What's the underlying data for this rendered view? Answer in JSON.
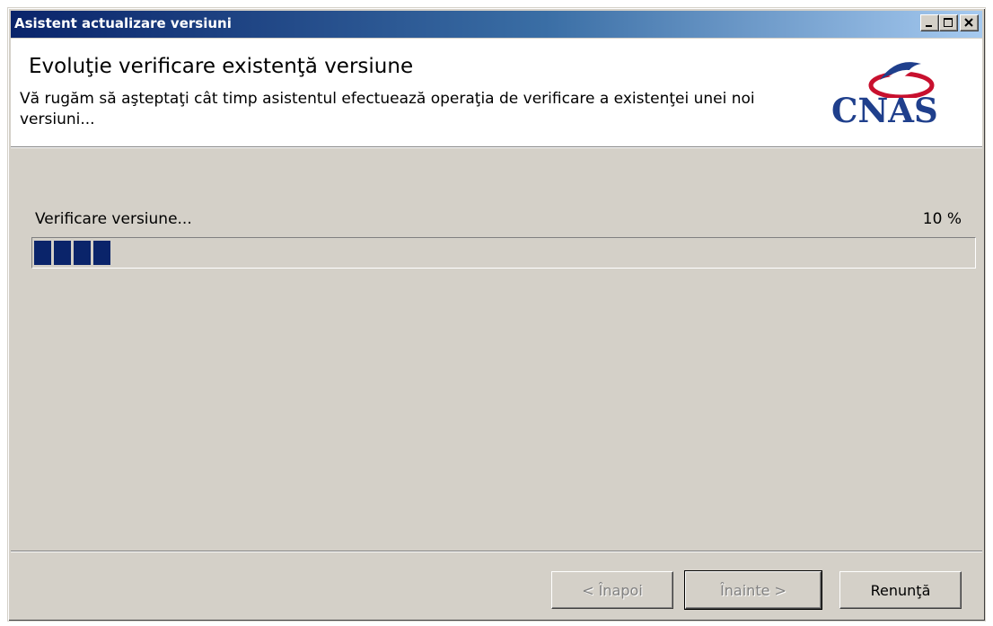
{
  "window": {
    "title": "Asistent actualizare versiuni",
    "controls": {
      "minimize_icon": "minimize-icon",
      "maximize_icon": "maximize-icon",
      "close_icon": "close-icon"
    }
  },
  "header": {
    "title": "Evoluţie verificare existenţă versiune",
    "description": "Vă rugăm să aşteptaţi cât timp asistentul efectuează operaţia de verificare a existenţei unei noi versiuni...",
    "logo_text": "CNAS"
  },
  "progress": {
    "label": "Verificare versiune...",
    "percent_text": "10 %",
    "value_percent": 10
  },
  "buttons": {
    "back_label": "< Înapoi",
    "next_label": "Înainte >",
    "cancel_label": "Renunţă",
    "back_enabled": false,
    "next_enabled": false,
    "cancel_enabled": true
  },
  "colors": {
    "title_bar_start": "#0a246a",
    "title_bar_end": "#a6caf0",
    "progress_fill": "#0a246a",
    "dialog_face": "#d4d0c8",
    "logo_blue": "#1f3f8c",
    "logo_red": "#c8102e"
  }
}
